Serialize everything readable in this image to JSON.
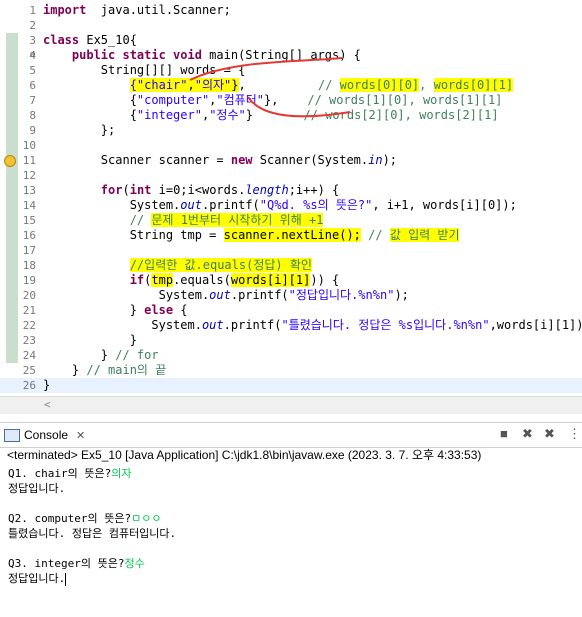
{
  "editor": {
    "lines": [
      {
        "n": "1",
        "segs": [
          [
            "kw",
            "import"
          ],
          [
            "",
            "  java.util.Scanner;"
          ]
        ]
      },
      {
        "n": "2",
        "segs": []
      },
      {
        "n": "3",
        "segs": [
          [
            "kw",
            "class"
          ],
          [
            "",
            " Ex5_10"
          ],
          [
            "",
            "{"
          ]
        ]
      },
      {
        "n": "4",
        "fold": "⊖",
        "segs": [
          [
            "",
            "    "
          ],
          [
            "kw",
            "public static void"
          ],
          [
            "",
            " main(String[] args) {"
          ]
        ]
      },
      {
        "n": "5",
        "segs": [
          [
            "",
            "        String[][] "
          ],
          [
            "",
            "words"
          ],
          [
            "",
            " = {"
          ]
        ]
      },
      {
        "n": "6",
        "segs": [
          [
            "",
            "            "
          ],
          [
            "hlstr",
            "{\"chair\""
          ],
          [
            "hl",
            ","
          ],
          [
            "hlstr",
            "\"의자\""
          ],
          [
            "hl",
            "}"
          ],
          [
            "",
            ",          "
          ],
          [
            "cm",
            "// "
          ],
          [
            "hlcm",
            "words[0][0]"
          ],
          [
            "cm",
            ", "
          ],
          [
            "hlcm",
            "words[0][1]"
          ]
        ]
      },
      {
        "n": "7",
        "segs": [
          [
            "",
            "            {"
          ],
          [
            "str",
            "\"computer\""
          ],
          [
            "",
            ","
          ],
          [
            "str",
            "\"컴퓨터\""
          ],
          [
            "",
            "},    "
          ],
          [
            "cm",
            "// words[1][0], words[1][1]"
          ]
        ]
      },
      {
        "n": "8",
        "segs": [
          [
            "",
            "            {"
          ],
          [
            "str",
            "\"integer\""
          ],
          [
            "",
            ","
          ],
          [
            "str",
            "\"정수\""
          ],
          [
            "",
            "}       "
          ],
          [
            "cm",
            "// words[2][0], words[2][1]"
          ]
        ]
      },
      {
        "n": "9",
        "segs": [
          [
            "",
            "        };"
          ]
        ]
      },
      {
        "n": "10",
        "segs": []
      },
      {
        "n": "11",
        "warn": true,
        "segs": [
          [
            "",
            "        Scanner scanner = "
          ],
          [
            "kw",
            "new"
          ],
          [
            "",
            " Scanner(System."
          ],
          [
            "fld",
            "in"
          ],
          [
            "",
            ");"
          ]
        ]
      },
      {
        "n": "12",
        "segs": []
      },
      {
        "n": "13",
        "segs": [
          [
            "",
            "        "
          ],
          [
            "kw",
            "for"
          ],
          [
            "",
            "("
          ],
          [
            "kw",
            "int"
          ],
          [
            "",
            " i=0;i<words."
          ],
          [
            "fld2",
            "length"
          ],
          [
            "",
            ";i++) {"
          ]
        ]
      },
      {
        "n": "14",
        "segs": [
          [
            "",
            "            System."
          ],
          [
            "fld",
            "out"
          ],
          [
            "",
            ".printf("
          ],
          [
            "str",
            "\"Q%d. %s의 뜻은?\""
          ],
          [
            "",
            ", i+1, words[i][0]);"
          ]
        ]
      },
      {
        "n": "15",
        "segs": [
          [
            "",
            "            "
          ],
          [
            "cm",
            "// "
          ],
          [
            "hlcm",
            "문제 1번부터 시작하기 위해 +1"
          ]
        ]
      },
      {
        "n": "16",
        "segs": [
          [
            "",
            "            String tmp = "
          ],
          [
            "hl",
            "scanner.nextLine();"
          ],
          [
            "",
            " "
          ],
          [
            "cm",
            "// "
          ],
          [
            "hlcm",
            "값 입력 받기"
          ]
        ]
      },
      {
        "n": "17",
        "segs": []
      },
      {
        "n": "18",
        "segs": [
          [
            "",
            "            "
          ],
          [
            "hlcm",
            "//입력한 값.equals(정답) 확인"
          ]
        ]
      },
      {
        "n": "19",
        "segs": [
          [
            "",
            "            "
          ],
          [
            "kw",
            "if"
          ],
          [
            "",
            "("
          ],
          [
            "hl",
            "tmp"
          ],
          [
            "",
            ".equals("
          ],
          [
            "hl",
            "words[i][1]"
          ],
          [
            "",
            ")) {"
          ]
        ]
      },
      {
        "n": "20",
        "segs": [
          [
            "",
            "                System."
          ],
          [
            "fld",
            "out"
          ],
          [
            "",
            ".printf("
          ],
          [
            "str",
            "\"정답입니다.%n%n\""
          ],
          [
            "",
            ");"
          ]
        ]
      },
      {
        "n": "21",
        "segs": [
          [
            "",
            "            } "
          ],
          [
            "kw",
            "else"
          ],
          [
            "",
            " {"
          ]
        ]
      },
      {
        "n": "22",
        "segs": [
          [
            "",
            "               System."
          ],
          [
            "fld",
            "out"
          ],
          [
            "",
            ".printf("
          ],
          [
            "str",
            "\"틀렸습니다. 정답은 %s입니다.%n%n\""
          ],
          [
            "",
            ",words[i][1]);"
          ]
        ]
      },
      {
        "n": "23",
        "segs": [
          [
            "",
            "            }"
          ]
        ]
      },
      {
        "n": "24",
        "segs": [
          [
            "",
            "        } "
          ],
          [
            "cm",
            "// for"
          ]
        ]
      },
      {
        "n": "25",
        "segs": [
          [
            "",
            "    } "
          ],
          [
            "cm",
            "// main의 끝"
          ]
        ]
      },
      {
        "n": "26",
        "current": true,
        "segs": [
          [
            "",
            "}"
          ]
        ]
      }
    ]
  },
  "console": {
    "tab_label": "Console",
    "close_glyph": "✕",
    "status": "<terminated> Ex5_10 [Java Application] C:\\jdk1.8\\bin\\javaw.exe (2023. 3. 7. 오후 4:33:53)",
    "output": [
      {
        "segs": [
          [
            "",
            "Q1. chair의 뜻은?"
          ],
          [
            "inp",
            "의자"
          ]
        ]
      },
      {
        "segs": [
          [
            "",
            "정답입니다."
          ]
        ]
      },
      {
        "segs": []
      },
      {
        "segs": [
          [
            "",
            "Q2. computer의 뜻은?"
          ],
          [
            "inp",
            "ㅁㅇㅇ"
          ]
        ]
      },
      {
        "segs": [
          [
            "",
            "틀렸습니다. 정답은 컴퓨터입니다."
          ]
        ]
      },
      {
        "segs": []
      },
      {
        "segs": [
          [
            "",
            "Q3. integer의 뜻은?"
          ],
          [
            "inp",
            "정수"
          ]
        ]
      },
      {
        "segs": [
          [
            "",
            "정답입니다."
          ]
        ],
        "caret": true
      }
    ]
  },
  "colors": {
    "keyword": "#7f0055",
    "string": "#2a00ff",
    "comment": "#3f7f5f",
    "highlight": "#ffff00",
    "user_input": "#00c853"
  }
}
